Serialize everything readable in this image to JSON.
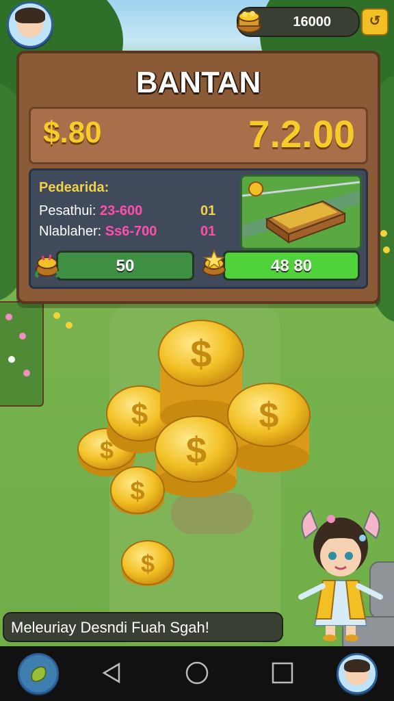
{
  "hud": {
    "currency_amount": "16000",
    "currency_icon": "coin-basket-icon",
    "add_icon": "add-currency-icon"
  },
  "panel": {
    "title": "BANTAN",
    "price_left": "$.80",
    "price_right": "7.2.00",
    "info_label": "Pedearida:",
    "rows": [
      {
        "label": "Pesathui:",
        "range": "23-600",
        "count": "01",
        "count_color": "#f1d24b"
      },
      {
        "label": "Nlablaher:",
        "range": "Ss6-700",
        "count": "01",
        "count_color": "#ff4fa8"
      }
    ],
    "bars": [
      {
        "value": "50",
        "color": "#3e8f44",
        "icon": "crop-basket-icon"
      },
      {
        "value": "48 80",
        "color": "#4fd23a",
        "icon": "star-basket-icon"
      }
    ]
  },
  "banner": {
    "text": "Meleuriay Desndi Fuah Sgah!"
  },
  "colors": {
    "panel_wood": "#8b5a36",
    "gold": "#f7cc2a",
    "pink": "#ff4fa8",
    "info_bg": "#404a5a"
  },
  "navbar": {
    "icons": [
      "inventory-icon",
      "back-icon",
      "home-icon",
      "recents-icon",
      "profile-icon"
    ]
  }
}
